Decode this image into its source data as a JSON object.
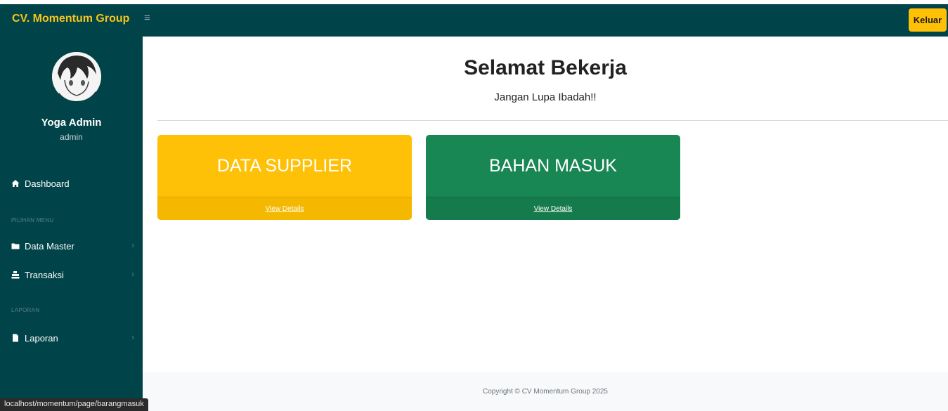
{
  "app": {
    "brand": "CV. Momentum Group",
    "logout_label": "Keluar"
  },
  "sidebar": {
    "user_name": "Yoga Admin",
    "user_role": "admin",
    "dashboard_label": "Dashboard",
    "section_menu": "PILIHAN MENU",
    "items_menu": [
      {
        "label": "Data Master",
        "icon": "folder-icon"
      },
      {
        "label": "Transaksi",
        "icon": "cash-register-icon"
      }
    ],
    "section_report": "LAPORAN",
    "items_report": [
      {
        "label": "Laporan",
        "icon": "file-icon"
      }
    ]
  },
  "main": {
    "title": "Selamat Bekerja",
    "subtitle": "Jangan Lupa Ibadah!!",
    "cards": [
      {
        "title": "DATA SUPPLIER",
        "link": "View Details",
        "color": "#ffc107"
      },
      {
        "title": "BAHAN MASUK",
        "link": "View Details",
        "color": "#198754"
      }
    ],
    "footer": "Copyright © CV Momentum Group 2025"
  },
  "statusbar": {
    "url": "localhost/momentum/page/barangmasuk"
  }
}
